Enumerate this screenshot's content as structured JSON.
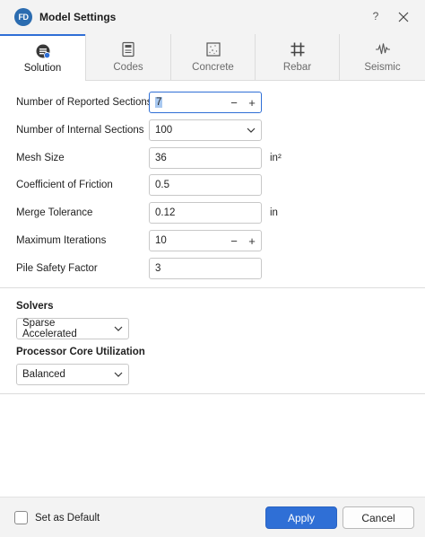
{
  "window": {
    "app_logo_text": "FD",
    "title": "Model Settings",
    "help_label": "?"
  },
  "tabs": [
    {
      "label": "Solution",
      "icon": "solution-icon",
      "active": true
    },
    {
      "label": "Codes",
      "icon": "codes-icon",
      "active": false
    },
    {
      "label": "Concrete",
      "icon": "concrete-icon",
      "active": false
    },
    {
      "label": "Rebar",
      "icon": "rebar-icon",
      "active": false
    },
    {
      "label": "Seismic",
      "icon": "seismic-icon",
      "active": false
    }
  ],
  "form": {
    "reported_sections": {
      "label": "Number of Reported Sections",
      "value": "7",
      "minus": "−",
      "plus": "+"
    },
    "internal_sections": {
      "label": "Number of Internal Sections",
      "value": "100"
    },
    "mesh_size": {
      "label": "Mesh Size",
      "value": "36",
      "unit": "in²"
    },
    "friction": {
      "label": "Coefficient of Friction",
      "value": "0.5"
    },
    "merge_tolerance": {
      "label": "Merge Tolerance",
      "value": "0.12",
      "unit": "in"
    },
    "max_iterations": {
      "label": "Maximum Iterations",
      "value": "10",
      "minus": "−",
      "plus": "+"
    },
    "pile_safety": {
      "label": "Pile Safety Factor",
      "value": "3"
    }
  },
  "solvers": {
    "title": "Solvers",
    "value": "Sparse Accelerated"
  },
  "processor": {
    "title": "Processor Core Utilization",
    "value": "Balanced"
  },
  "footer": {
    "default_label": "Set as Default",
    "default_checked": false,
    "apply_label": "Apply",
    "cancel_label": "Cancel"
  },
  "colors": {
    "accent": "#2f6fd6",
    "chrome": "#f3f3f3",
    "border": "#c8c8c8"
  }
}
